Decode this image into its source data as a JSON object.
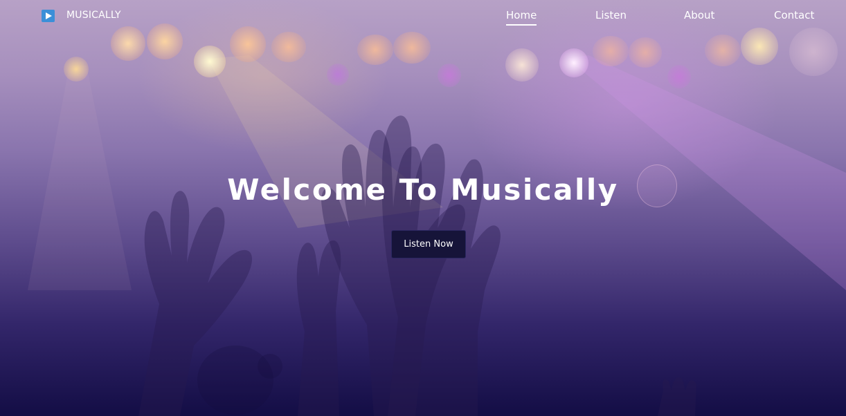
{
  "brand": {
    "name": "MUSICALLY",
    "logo_icon": "play-icon",
    "logo_color": "#3b8fd8"
  },
  "nav": {
    "items": [
      {
        "label": "Home",
        "active": true
      },
      {
        "label": "Listen",
        "active": false
      },
      {
        "label": "About",
        "active": false
      },
      {
        "label": "Contact",
        "active": false
      }
    ]
  },
  "hero": {
    "headline": "Welcome To Musically",
    "cta_label": "Listen Now",
    "cta_color": "#161439",
    "gradient_top": "#b7a1c6",
    "gradient_bottom": "#130d45"
  }
}
